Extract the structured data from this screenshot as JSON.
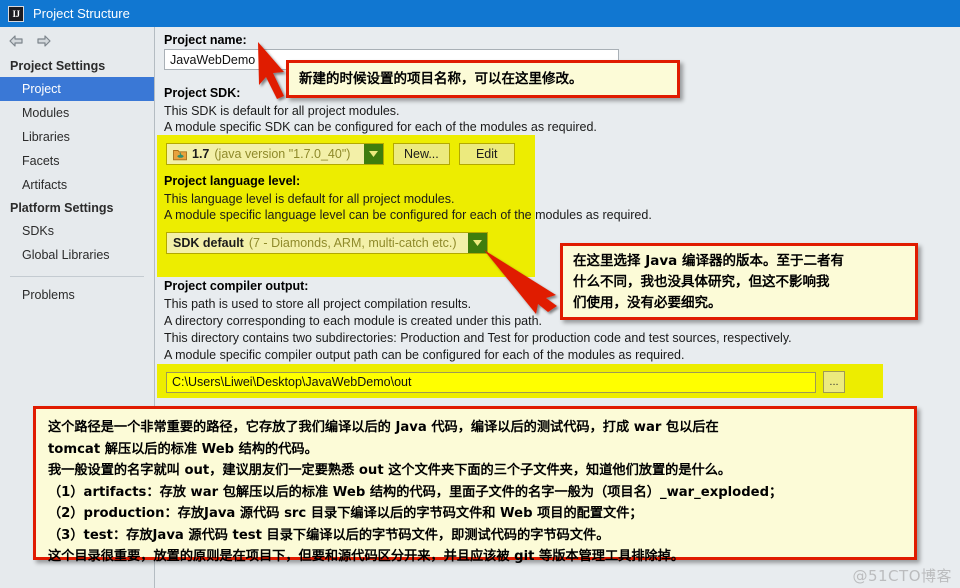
{
  "window": {
    "title": "Project Structure",
    "icon": "IJ"
  },
  "nav": {
    "back_icon": "arrow-left-icon",
    "forward_icon": "arrow-right-icon"
  },
  "sidebar": {
    "groups": [
      {
        "label": "Project Settings",
        "items": [
          {
            "label": "Project",
            "selected": true
          },
          {
            "label": "Modules",
            "selected": false
          },
          {
            "label": "Libraries",
            "selected": false
          },
          {
            "label": "Facets",
            "selected": false
          },
          {
            "label": "Artifacts",
            "selected": false
          }
        ]
      },
      {
        "label": "Platform Settings",
        "items": [
          {
            "label": "SDKs",
            "selected": false
          },
          {
            "label": "Global Libraries",
            "selected": false
          }
        ]
      }
    ],
    "problems_label": "Problems"
  },
  "main": {
    "project_name": {
      "label": "Project name:",
      "value": "JavaWebDemo"
    },
    "project_sdk": {
      "label": "Project SDK:",
      "desc1": "This SDK is default for all project modules.",
      "desc2": "A module specific SDK can be configured for each of the modules as required.",
      "combo_strong": "1.7",
      "combo_dim": "(java version \"1.7.0_40\")",
      "combo_icon": "java-sdk-folder-icon",
      "new_button": "New...",
      "edit_button": "Edit"
    },
    "language_level": {
      "label": "Project language level:",
      "desc1": "This language level is default for all project modules.",
      "desc2": "A module specific language level can be configured for each of the modules as required.",
      "combo_strong": "SDK default",
      "combo_dim": "(7 - Diamonds, ARM, multi-catch etc.)"
    },
    "compiler_output": {
      "label": "Project compiler output:",
      "desc1": "This path is used to store all project compilation results.",
      "desc2": "A directory corresponding to each module is created under this path.",
      "desc3": "This directory contains two subdirectories: Production and Test for production code and test sources, respectively.",
      "desc4": "A module specific compiler output path can be configured for each of the modules as required.",
      "path_value": "C:\\Users\\Liwei\\Desktop\\JavaWebDemo\\out",
      "browse_button": "..."
    }
  },
  "annotations": {
    "project_name_note": "新建的时候设置的项目名称，可以在这里修改。",
    "language_level_note": "在这里选择 Java 编译器的版本。至于二者有\n什么不同，我也没具体研究，但这不影响我\n们使用，没有必要细究。",
    "compiler_output_note": "这个路径是一个非常重要的路径，它存放了我们编译以后的 Java 代码，编译以后的测试代码，打成 war 包以后在\ntomcat 解压以后的标准 Web 结构的代码。\n我一般设置的名字就叫 out，建议朋友们一定要熟悉 out 这个文件夹下面的三个子文件夹，知道他们放置的是什么。\n（1）artifacts：存放 war 包解压以后的标准 Web 结构的代码，里面子文件的名字一般为（项目名）_war_exploded；\n（2）production：存放Java 源代码 src 目录下编译以后的字节码文件和 Web 项目的配置文件；\n（3）test：存放Java 源代码 test 目录下编译以后的字节码文件，即测试代码的字节码文件。\n这个目录很重要，放置的原则是在项目下，但要和源代码区分开来，并且应该被 git 等版本管理工具排除掉。"
  },
  "watermark": "@51CTO博客",
  "colors": {
    "titlebar": "#1177d1",
    "selection": "#3a78d6",
    "highlight": "#eded00",
    "callout_border": "#e01b00",
    "callout_bg": "#fcfbd7",
    "arrow": "#e01b00",
    "combo_arrow": "#3f7d0d"
  }
}
